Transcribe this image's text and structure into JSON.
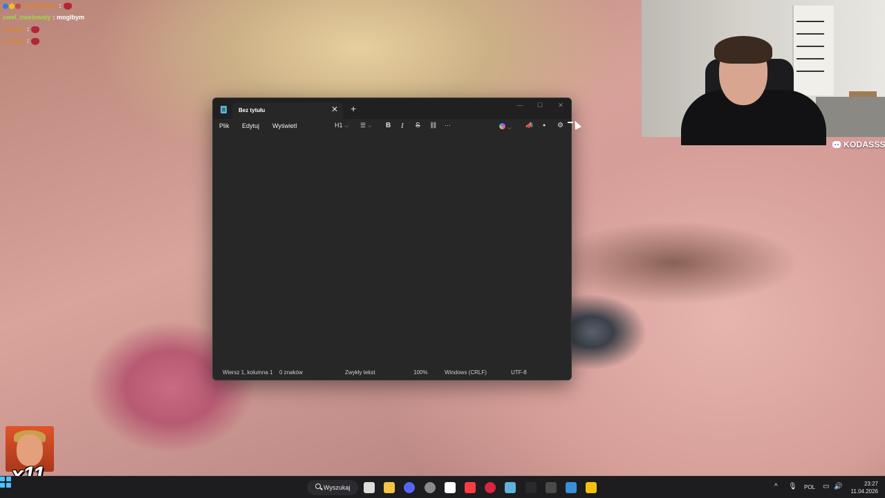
{
  "chat": {
    "messages": [
      {
        "user": "maksymser",
        "message": ":",
        "user_color": "#d9862d",
        "has_badges": true
      },
      {
        "user": "cwel_cwelowaty",
        "message": ": moglbym",
        "user_color": "#9edc43"
      },
      {
        "user": "karppik",
        "message": ":",
        "user_color": "#d9862d"
      },
      {
        "user": "karppik",
        "message": ":",
        "user_color": "#d9862d"
      }
    ]
  },
  "discord": {
    "handle": "KODASSS"
  },
  "emote_overlay": {
    "count": "x11"
  },
  "notepad": {
    "tab_title": "Bez tytułu",
    "new_tab": "+",
    "tab_close": "✕",
    "window_buttons": {
      "minimize": "—",
      "maximize": "☐",
      "close": "✕"
    },
    "menu": {
      "file": "Plik",
      "edit": "Edytuj",
      "view": "Wyświetl"
    },
    "toolbar": {
      "heading": "H1",
      "heading_chevron": "⌵",
      "list_icon": "☰",
      "list_chevron": "⌵",
      "bold": "B",
      "italic": "I",
      "strike": "S",
      "link": "⛓",
      "more": "···",
      "copilot_chevron": "⌵",
      "megaphone": "📣",
      "account": "●",
      "settings": "⚙"
    },
    "status": {
      "position": "Wiersz 1, kolumna 1",
      "chars": "0 znaków",
      "format": "Zwykły tekst",
      "zoom": "100%",
      "line_endings": "Windows (CRLF)",
      "encoding": "UTF-8"
    }
  },
  "taskbar": {
    "search_label": "Wyszukaj",
    "language": "POL",
    "time": "23:27",
    "date": "11.04.2026",
    "tray_chevron": "^",
    "mic": "🎙",
    "volume": "🔊",
    "display": "▭",
    "pinned": [
      "task-view",
      "file-explorer",
      "discord",
      "chrome",
      "logitech",
      "apple-music",
      "opera",
      "notepad",
      "epic-games",
      "terminal",
      "photos",
      "rockstar"
    ],
    "icon_colors": [
      "#dcdcdc",
      "#f6c445",
      "#5865f2",
      "#8a8a8a",
      "#ffffff",
      "#fc3c44",
      "#d7263d",
      "#5fb3d9",
      "#2a2a2a",
      "#4a4a4a",
      "#3a8fd6",
      "#f4c20d"
    ]
  }
}
